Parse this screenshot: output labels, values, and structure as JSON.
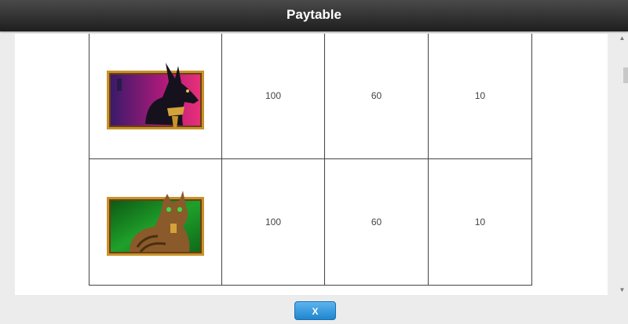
{
  "header": {
    "title": "Paytable"
  },
  "paytable": {
    "rows": [
      {
        "symbol_icon": "anubis-dog-icon",
        "pays": [
          "100",
          "60",
          "10"
        ]
      },
      {
        "symbol_icon": "egyptian-cat-icon",
        "pays": [
          "100",
          "60",
          "10"
        ]
      }
    ]
  },
  "footer": {
    "close_label": "X"
  },
  "colors": {
    "header_top": "#4a4a4a",
    "header_bottom": "#1e1e1e",
    "button_top": "#5db4ef",
    "button_bottom": "#1f86cf",
    "dog_background": "#b01a7a",
    "cat_background": "#1fa02a",
    "frame_gold": "#c9922b"
  }
}
